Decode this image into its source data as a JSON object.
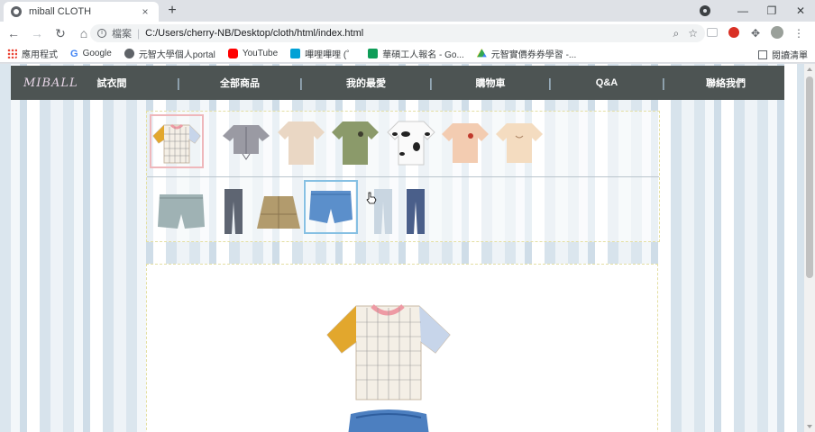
{
  "browser": {
    "tab_title": "miball CLOTH",
    "tab_close": "×",
    "new_tab": "+",
    "window_controls": [
      "—",
      "❐",
      "✕"
    ],
    "address_scheme": "檔案",
    "address_url": "C:/Users/cherry-NB/Desktop/cloth/html/index.html",
    "bookmarks": [
      "應用程式",
      "Google",
      "元智大學個人portal",
      "YouTube",
      "嗶哩嗶哩 (゜",
      "華碩工人報名 - Go...",
      "元智實價券券學習 -..."
    ],
    "reading_list": "閱讀清單"
  },
  "site": {
    "logo": "MIBALL",
    "nav": [
      "試衣間",
      "全部商品",
      "我的最愛",
      "購物車",
      "Q&A",
      "聯絡我們"
    ],
    "nav_divider": "|"
  },
  "wardrobe": {
    "tops": [
      {
        "name": "grid-colorblock-tee",
        "selected": true
      },
      {
        "name": "gray-cropped-shirt",
        "selected": false
      },
      {
        "name": "beige-tee",
        "selected": false
      },
      {
        "name": "olive-tee",
        "selected": false
      },
      {
        "name": "cow-print-tee",
        "selected": false
      },
      {
        "name": "peach-embroidered-tee",
        "selected": false
      },
      {
        "name": "cream-tee",
        "selected": false
      }
    ],
    "bottoms": [
      {
        "name": "denim-drawstring-shorts",
        "selected": false
      },
      {
        "name": "gray-jeans",
        "selected": false
      },
      {
        "name": "plaid-skirt",
        "selected": false
      },
      {
        "name": "blue-denim-shorts",
        "selected": true
      },
      {
        "name": "light-wash-jeans",
        "selected": false
      },
      {
        "name": "dark-wash-jeans",
        "selected": false
      }
    ]
  },
  "colors": {
    "nav_bg": "#4d5453",
    "selected_top_border": "#efb7bb",
    "selected_bottom_border": "#86c0e3"
  }
}
